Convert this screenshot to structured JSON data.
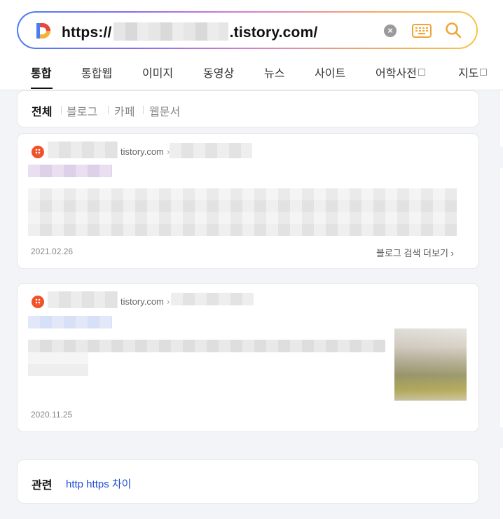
{
  "search": {
    "url_prefix": "https://",
    "url_suffix": ".tistory.com/"
  },
  "tabs": [
    "통합",
    "통합웹",
    "이미지",
    "동영상",
    "뉴스",
    "사이트",
    "어학사전",
    "지도"
  ],
  "filters": [
    "전체",
    "블로그",
    "카페",
    "웹문서"
  ],
  "results": [
    {
      "domain": "tistory.com",
      "date": "2021.02.26",
      "more": "블로그 검색 더보기"
    },
    {
      "domain": "tistory.com",
      "date": "2020.11.25"
    }
  ],
  "related": {
    "label": "관련",
    "link": "http https 차이"
  },
  "colors": {
    "favicon": "#f0522a",
    "link": "#1f4fd6",
    "accent_orange": "#f0a437"
  },
  "icons": [
    "daum-logo-icon",
    "clear-icon",
    "keyboard-icon",
    "search-icon",
    "external-link-icon",
    "tistory-favicon-icon",
    "chevron-right-icon"
  ]
}
